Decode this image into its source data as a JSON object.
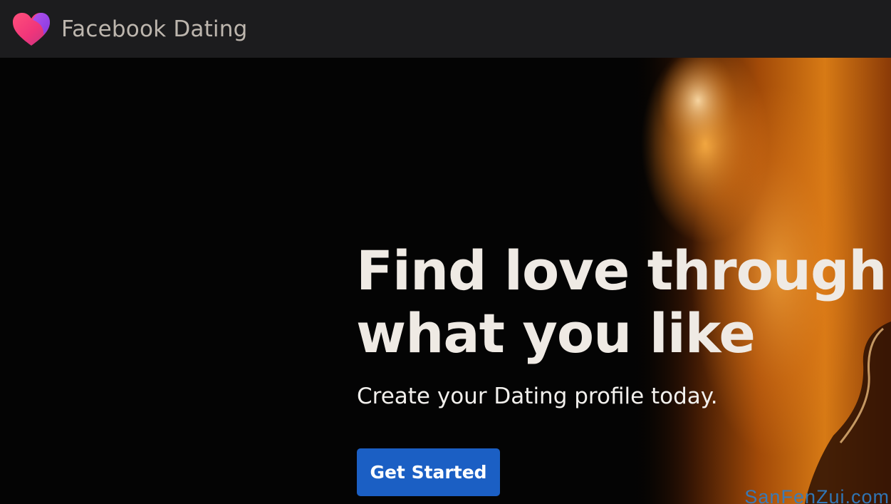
{
  "header": {
    "logo_icon": "heart-icon",
    "brand": "Facebook Dating",
    "background": "#1c1c1e",
    "brand_color": "#bdb6ae"
  },
  "hero": {
    "image": "photo-of-person-in-warm-orange-light",
    "headline_line1": "Find love through",
    "headline_line2": "what you like",
    "subhead": "Create your Dating profile today.",
    "cta_label": "Get Started",
    "cta_color": "#1b5fc4"
  },
  "watermark": "SanFenZui.com"
}
